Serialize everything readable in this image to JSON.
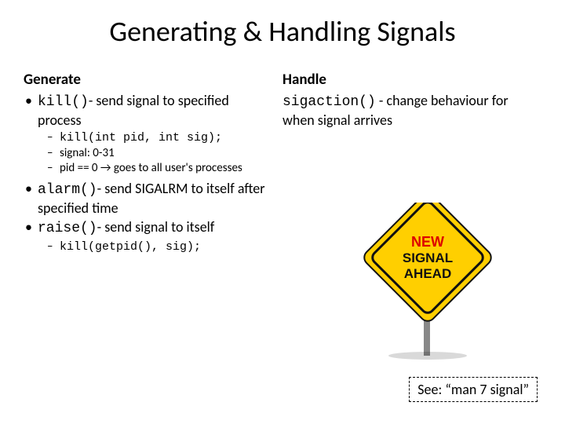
{
  "title": "Generating & Handling Signals",
  "left": {
    "header": "Generate",
    "bullets": [
      {
        "code": "kill()",
        "rest": "- send signal to specified process",
        "sub": [
          {
            "code": "kill(int pid, int sig);",
            "rest": ""
          },
          {
            "code": "",
            "rest": "signal: 0-31"
          },
          {
            "code": "",
            "rest": "pid == 0 → goes to all user's processes"
          }
        ]
      },
      {
        "code": "alarm()",
        "rest": "- send SIGALRM to itself after specified time",
        "sub": []
      },
      {
        "code": "raise()",
        "rest": "- send signal to itself",
        "sub": [
          {
            "code": "kill(getpid(), sig);",
            "rest": ""
          }
        ]
      }
    ]
  },
  "right": {
    "header": "Handle",
    "code": "sigaction()",
    "rest": " - change behaviour for when signal arrives"
  },
  "sign": {
    "line1": "NEW",
    "line2": "SIGNAL",
    "line3": "AHEAD"
  },
  "see": "See: “man 7 signal”"
}
